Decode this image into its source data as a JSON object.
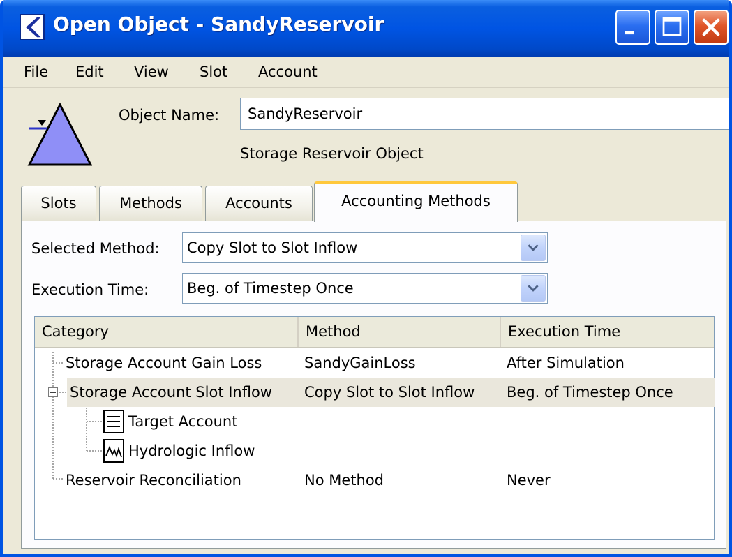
{
  "window": {
    "title": "Open Object - SandyReservoir"
  },
  "menu": [
    "File",
    "Edit",
    "View",
    "Slot",
    "Account"
  ],
  "object": {
    "name_label": "Object Name:",
    "name_value": "SandyReservoir",
    "type": "Storage Reservoir Object"
  },
  "tabs": [
    "Slots",
    "Methods",
    "Accounts",
    "Accounting Methods"
  ],
  "active_tab": "Accounting Methods",
  "form": {
    "selected_method_label": "Selected Method:",
    "selected_method_value": "Copy Slot to Slot Inflow",
    "execution_time_label": "Execution Time:",
    "execution_time_value": "Beg. of Timestep Once"
  },
  "tree": {
    "columns": [
      "Category",
      "Method",
      "Execution Time"
    ],
    "rows": [
      {
        "category": "Storage Account Gain Loss",
        "method": "SandyGainLoss",
        "execution": "After Simulation"
      },
      {
        "category": "Storage Account Slot Inflow",
        "method": "Copy Slot to Slot Inflow",
        "execution": "Beg. of Timestep Once",
        "selected": true,
        "expanded": true
      },
      {
        "category": "Target Account",
        "method": "",
        "execution": "",
        "icon": "table-icon"
      },
      {
        "category": "Hydrologic Inflow",
        "method": "",
        "execution": "",
        "icon": "timeseries-icon"
      },
      {
        "category": "Reservoir Reconciliation",
        "method": "No Method",
        "execution": "Never"
      }
    ]
  }
}
